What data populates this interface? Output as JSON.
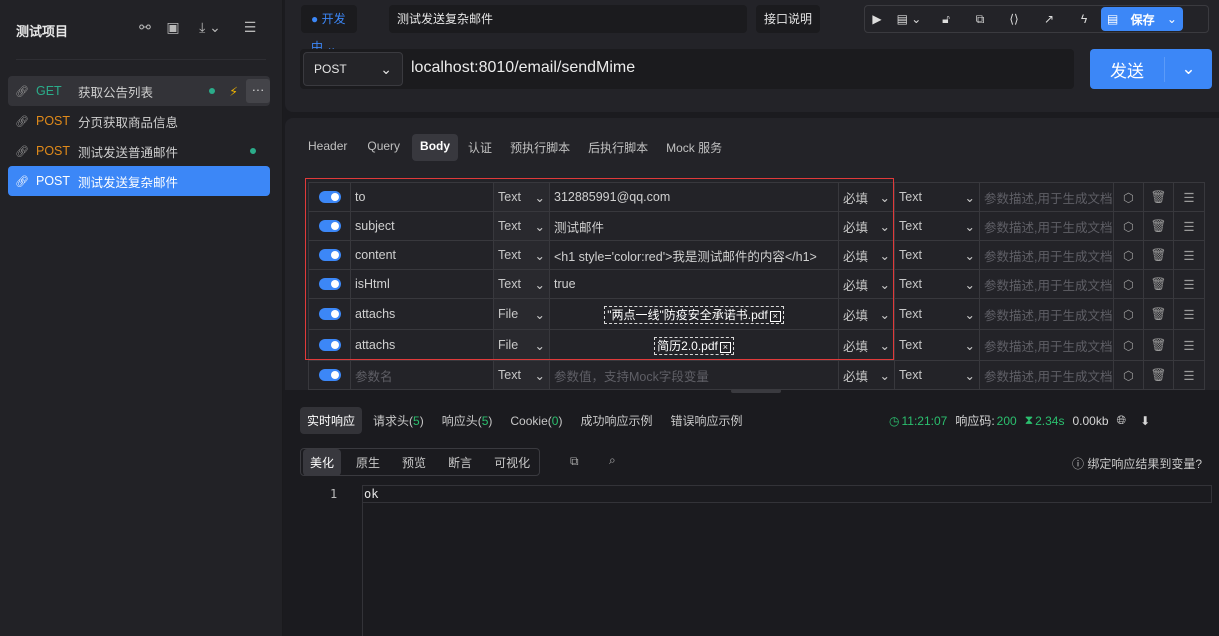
{
  "sidebar": {
    "project_title": "测试项目",
    "items": [
      {
        "method": "GET",
        "name": "获取公告列表"
      },
      {
        "method": "POST",
        "name": "分页获取商品信息"
      },
      {
        "method": "POST",
        "name": "测试发送普通邮件"
      },
      {
        "method": "POST",
        "name": "测试发送复杂邮件"
      }
    ]
  },
  "header": {
    "status": "开发中",
    "api_name": "测试发送复杂邮件",
    "doc_button": "接口说明",
    "save": "保存"
  },
  "request": {
    "method": "POST",
    "url": "localhost:8010/email/sendMime",
    "send": "发送"
  },
  "tabs": [
    "Header",
    "Query",
    "Body",
    "认证",
    "预执行脚本",
    "后执行脚本",
    "Mock 服务"
  ],
  "params": {
    "rows": [
      {
        "name": "to",
        "type": "Text",
        "value": "312885991@qq.com",
        "required": "必填",
        "type2": "Text",
        "desc": "参数描述,用于生成文档"
      },
      {
        "name": "subject",
        "type": "Text",
        "value": "测试邮件",
        "required": "必填",
        "type2": "Text",
        "desc": "参数描述,用于生成文档"
      },
      {
        "name": "content",
        "type": "Text",
        "value": "<h1 style='color:red'>我是测试邮件的内容</h1>",
        "required": "必填",
        "type2": "Text",
        "desc": "参数描述,用于生成文档"
      },
      {
        "name": "isHtml",
        "type": "Text",
        "value": "true",
        "required": "必填",
        "type2": "Text",
        "desc": "参数描述,用于生成文档"
      },
      {
        "name": "attachs",
        "type": "File",
        "value": "\"两点一线\"防疫安全承诺书.pdf",
        "required": "必填",
        "type2": "Text",
        "desc": "参数描述,用于生成文档"
      },
      {
        "name": "attachs",
        "type": "File",
        "value": "简历2.0.pdf",
        "required": "必填",
        "type2": "Text",
        "desc": "参数描述,用于生成文档"
      }
    ],
    "new_row": {
      "name_placeholder": "参数名",
      "type": "Text",
      "value_placeholder": "参数值，支持Mock字段变量",
      "required": "必填",
      "type2": "Text",
      "desc_placeholder": "参数描述,用于生成文档"
    }
  },
  "response": {
    "tabs": {
      "live": "实时响应",
      "req_headers": "请求头(",
      "req_count": "5",
      "resp_headers": "响应头(",
      "resp_count": "5",
      "cookie": "Cookie(",
      "cookie_count": "0",
      "close": ")",
      "success": "成功响应示例",
      "error": "错误响应示例"
    },
    "time": "11:21:07",
    "code_label": "响应码:",
    "code": "200",
    "duration": "2.34s",
    "size": "0.00kb",
    "view_tabs": [
      "美化",
      "原生",
      "预览",
      "断言",
      "可视化"
    ],
    "bind_var": "绑定响应结果到变量?",
    "line": "1",
    "body": "ok"
  }
}
